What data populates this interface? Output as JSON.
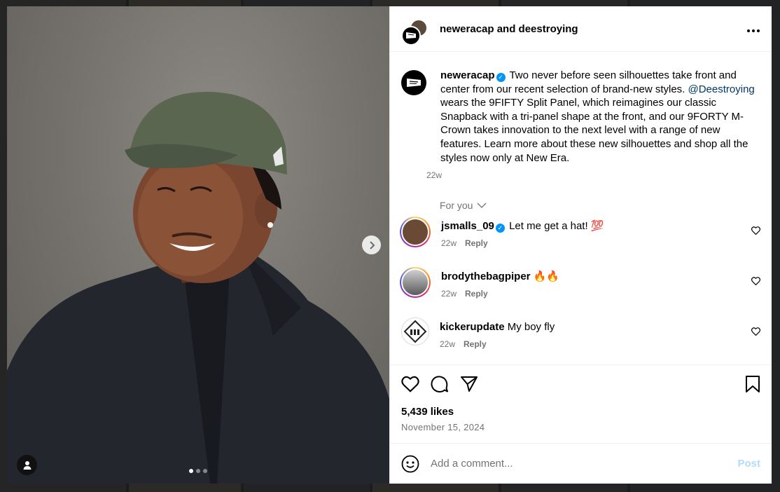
{
  "post": {
    "header_title": "neweracap and deestroying",
    "more_icon": "more-horizontal-icon"
  },
  "caption": {
    "username": "neweracap",
    "text_part1": " Two never before seen silhouettes take front and center from our recent selection of brand-new styles. ",
    "mention": "@Deestroying",
    "text_part2": " wears the 9FIFTY Split Panel, which reimagines our classic Snapback with a tri-panel shape at the front, and our 9FORTY M-Crown takes innovation to the next level with a range of new features. Learn more about these new silhouettes and shop all the styles now only at New Era.",
    "time": "22w"
  },
  "filter": {
    "label": "For you"
  },
  "comments": [
    {
      "username": "jsmalls_09",
      "verified": true,
      "text": " Let me get a hat! 💯",
      "time": "22w",
      "reply": "Reply"
    },
    {
      "username": "brodythebagpiper",
      "verified": false,
      "text": " 🔥🔥",
      "time": "22w",
      "reply": "Reply"
    },
    {
      "username": "kickerupdate",
      "verified": false,
      "text": " My boy fly",
      "time": "22w",
      "reply": "Reply"
    }
  ],
  "stats": {
    "likes": "5,439 likes",
    "date": "November 15, 2024"
  },
  "composer": {
    "placeholder": "Add a comment...",
    "post_label": "Post"
  },
  "media": {
    "slide_count": 3,
    "active_slide": 1
  },
  "colors": {
    "accent": "#0095f6",
    "mention": "#00376b",
    "muted": "#737373",
    "post_disabled": "#b3dbff"
  }
}
